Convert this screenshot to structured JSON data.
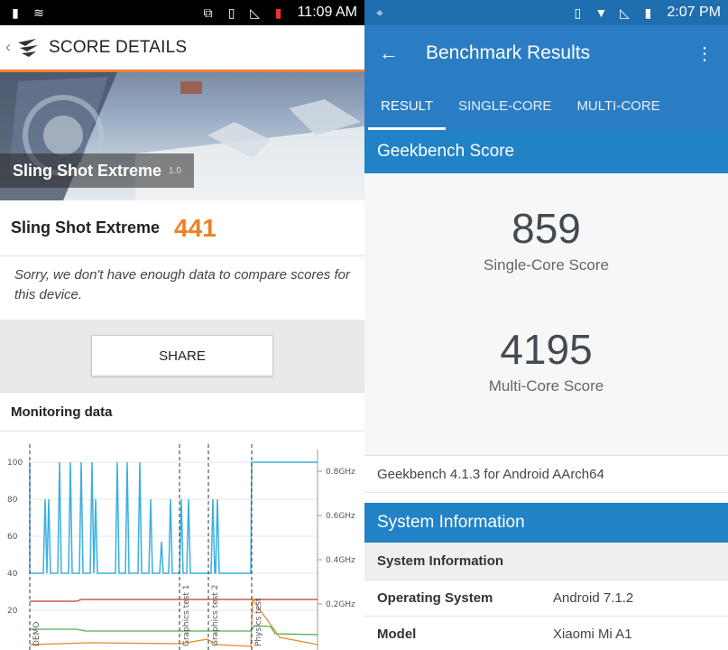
{
  "left": {
    "status_time": "11:09 AM",
    "title": "SCORE DETAILS",
    "banner": {
      "title": "Sling Shot Extreme",
      "version": "1.0"
    },
    "score": {
      "name": "Sling Shot Extreme",
      "value": "441"
    },
    "message": "Sorry, we don't have enough data to compare scores for this device.",
    "share_label": "SHARE",
    "monitoring_title": "Monitoring data",
    "chart_data": {
      "type": "line",
      "y_left_ticks": [
        "100",
        "80",
        "60",
        "40",
        "20"
      ],
      "y_right_ticks": [
        "0.8GHz",
        "0.6GHz",
        "0.4GHz",
        "0.2GHz"
      ],
      "markers": [
        "DEMO",
        "Graphics test 1",
        "Graphics test 2",
        "Physics test"
      ],
      "colors": {
        "cpu_load": "#3ab0e0",
        "temperature": "#c0392b",
        "battery": "#4caf50",
        "frequency": "#e8862a"
      }
    }
  },
  "right": {
    "status_time": "2:07 PM",
    "title": "Benchmark Results",
    "tabs": [
      "RESULT",
      "SINGLE-CORE",
      "MULTI-CORE"
    ],
    "score_header": "Geekbench Score",
    "single_core": {
      "value": "859",
      "label": "Single-Core Score"
    },
    "multi_core": {
      "value": "4195",
      "label": "Multi-Core Score"
    },
    "version_line": "Geekbench 4.1.3 for Android AArch64",
    "system_header": "System Information",
    "system_subheader": "System Information",
    "rows": [
      {
        "key": "Operating System",
        "value": "Android 7.1.2"
      },
      {
        "key": "Model",
        "value": "Xiaomi Mi A1"
      }
    ]
  }
}
